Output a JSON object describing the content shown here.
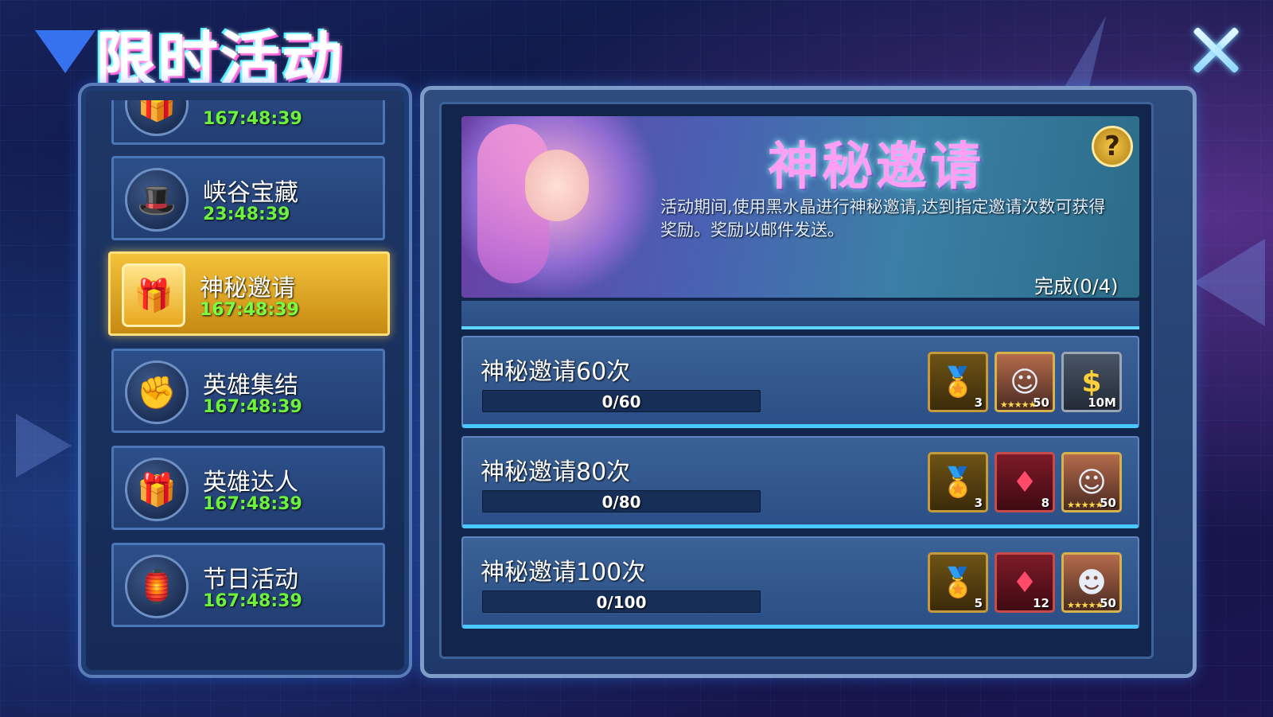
{
  "page_title": "限时活动",
  "close_glyph": "×",
  "sidebar": {
    "items": [
      {
        "name": "",
        "timer": "167:48:39",
        "icon": "gift-box-icon"
      },
      {
        "name": "峡谷宝藏",
        "timer": "23:48:39",
        "icon": "explorer-hat-icon"
      },
      {
        "name": "神秘邀请",
        "timer": "167:48:39",
        "icon": "mystery-gift-icon",
        "active": true
      },
      {
        "name": "英雄集结",
        "timer": "167:48:39",
        "icon": "gauntlet-icon"
      },
      {
        "name": "英雄达人",
        "timer": "167:48:39",
        "icon": "blue-gift-icon"
      },
      {
        "name": "节日活动",
        "timer": "167:48:39",
        "icon": "lantern-icon"
      }
    ]
  },
  "banner": {
    "title": "神秘邀请",
    "description": "活动期间,使用黑水晶进行神秘邀请,达到指定邀请次数可获得奖励。奖励以邮件发送。",
    "help_label": "?",
    "completion": "完成(0/4)"
  },
  "tasks": [
    {
      "title": "神秘邀请60次",
      "progress_text": "0/60",
      "progress": 0,
      "rewards": [
        {
          "type": "gold-badge-icon",
          "count": "3",
          "stars": ""
        },
        {
          "type": "hero-portrait-blonde-icon",
          "count": "50",
          "stars": "★★★★★"
        },
        {
          "type": "gold-coin-icon",
          "count": "10M",
          "stars": ""
        }
      ]
    },
    {
      "title": "神秘邀请80次",
      "progress_text": "0/80",
      "progress": 0,
      "rewards": [
        {
          "type": "gold-badge-icon",
          "count": "3",
          "stars": ""
        },
        {
          "type": "red-gem-icon",
          "count": "8",
          "stars": ""
        },
        {
          "type": "hero-portrait-redhair-icon",
          "count": "50",
          "stars": "★★★★★"
        }
      ]
    },
    {
      "title": "神秘邀请100次",
      "progress_text": "0/100",
      "progress": 0,
      "rewards": [
        {
          "type": "gold-badge-icon",
          "count": "5",
          "stars": ""
        },
        {
          "type": "red-gem-icon",
          "count": "12",
          "stars": ""
        },
        {
          "type": "hero-portrait-wolf-icon",
          "count": "50",
          "stars": "★★★★★"
        }
      ]
    }
  ],
  "icons": {
    "gift-box-icon": "🎁",
    "explorer-hat-icon": "🎩",
    "mystery-gift-icon": "🎁",
    "gauntlet-icon": "✊",
    "blue-gift-icon": "🎁",
    "lantern-icon": "🏮",
    "gold-badge-icon": "🏅",
    "gold-coin-icon": "$",
    "red-gem-icon": "♦",
    "hero-portrait-blonde-icon": "☺",
    "hero-portrait-redhair-icon": "☺",
    "hero-portrait-wolf-icon": "☻"
  }
}
